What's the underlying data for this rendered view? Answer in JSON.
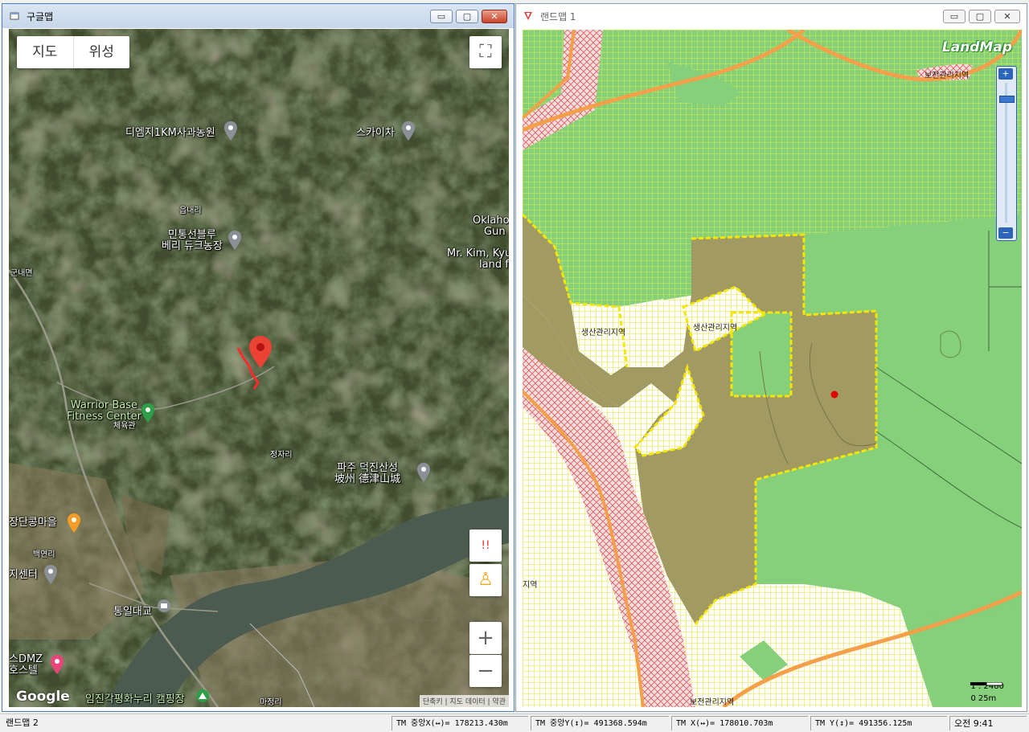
{
  "left_window": {
    "title": "구글맵",
    "maptype": {
      "map": "지도",
      "satellite": "위성"
    },
    "labels": {
      "orchard": "디엠지1KM사과농원",
      "skycha": "스카이차",
      "eupnae": "읍내리",
      "berry_1": "민통선블루",
      "berry_2": "베리 듀크농장",
      "oklahoma_1": "Oklaho",
      "oklahoma_2": "Gun",
      "mrkim_1": "Mr. Kim, Kyu",
      "mrkim_2": "land fo",
      "gunnaemyeon": "군내면",
      "warrior_1": "Warrior Base",
      "warrior_2": "Fitness Center",
      "gym": "체육관",
      "jeongja": "정자리",
      "fortress_1": "파주 덕진산성",
      "fortress_2": "坡州 德津山城",
      "jangdan": "장단콩마을",
      "baegyeon": "백연리",
      "jisenter": "지센터",
      "tongil": "통일대교",
      "dmz_1": "스DMZ",
      "dmz_2": "호스텔",
      "camping": "임진각평화누리 캠핑장",
      "majeong": "마정리"
    },
    "google": "Google",
    "attribution": "단축키 | 지도 데이터 | 약관",
    "icons": {
      "fullscreen": "⛶",
      "alert": "!!",
      "pegman": "♙",
      "zoom_in": "+",
      "zoom_out": "−"
    }
  },
  "right_window": {
    "title": "랜드맵 1",
    "logo": "LandMap",
    "zones": {
      "bojeon_top": "보전관리지역",
      "saengsan_1": "생산관리지역",
      "saengsan_2": "생산관리지역",
      "jiyeok_left": "지역",
      "bojeon_bottom": "보전관리지역"
    },
    "zoom": {
      "in": "+",
      "out": "−"
    },
    "scale_ratio": "1 : 2480",
    "scale_left": "0",
    "scale_right": "25m"
  },
  "titlebar_buttons": {
    "minimize": "▭",
    "maximize": "▢",
    "close": "✕"
  },
  "status_bar": {
    "app": "랜드맵 2",
    "tm_center_x": "TM 중앙X(↔)= 178213.430m",
    "tm_center_y": "TM 중앙Y(↕)= 491368.594m",
    "tm_x": "TM X(↔)= 178010.703m",
    "tm_y": "TM Y(↕)= 491356.125m",
    "time": "오전 9:41"
  },
  "colors": {
    "satellite_base": "#3d4a2c",
    "river": "#4b5a4e",
    "marker": "#e53935",
    "zone_green": "#86cf7b",
    "zone_olive": "#a19a62",
    "zone_yellow_grid": "#f0ee4a",
    "zone_red_hatch": "#e05a5a",
    "road": "#f4a04a",
    "boundary": "#f5e700"
  }
}
